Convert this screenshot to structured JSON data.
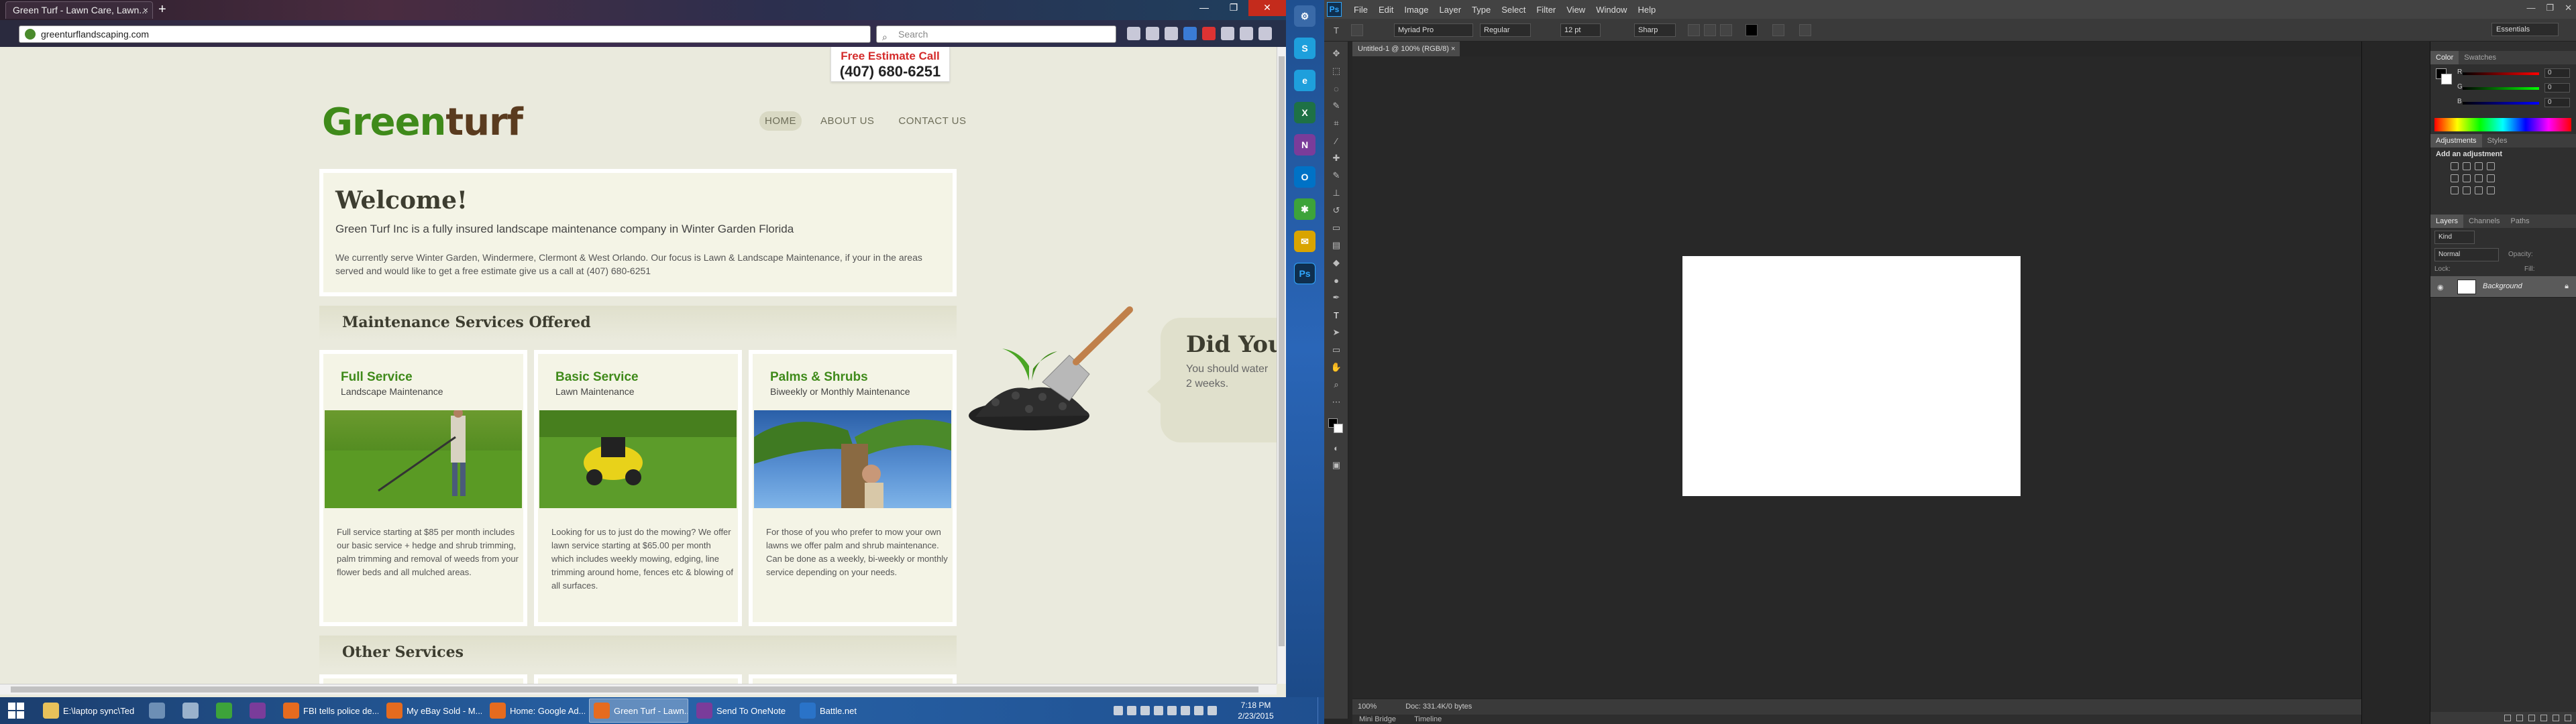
{
  "browser": {
    "tab_title": "Green Turf - Lawn Care, Lawn...",
    "tab_close": "×",
    "new_tab": "+",
    "url": "greenturflandscaping.com",
    "search_placeholder": "Search"
  },
  "site": {
    "logo_green": "Green",
    "logo_brown": "turf",
    "estimate_label": "Free Estimate Call",
    "estimate_phone": "(407) 680-6251",
    "nav": [
      "HOME",
      "ABOUT US",
      "CONTACT US"
    ],
    "welcome_title": "Welcome!",
    "welcome_lead": "Green Turf Inc is a fully insured landscape maintenance company in Winter Garden Florida",
    "welcome_body": "We currently serve Winter Garden, Windermere, Clermont & West Orlando. Our focus is Lawn & Landscape Maintenance, if your in the areas served and would like to get a free estimate give us a call at (407) 680-6251",
    "maintenance_heading": "Maintenance Services Offered",
    "other_heading": "Other Services",
    "cards": [
      {
        "title": "Full Service",
        "subtitle": "Landscape Maintenance",
        "desc": "Full service starting at $85 per month includes our basic service + hedge and shrub trimming, palm trimming and removal of weeds from your flower beds and all mulched areas."
      },
      {
        "title": "Basic Service",
        "subtitle": "Lawn Maintenance",
        "desc": "Looking for us to just do the mowing? We offer lawn service starting at $65.00 per month which includes weekly mowing, edging, line trimming around home, fences etc & blowing of all surfaces."
      },
      {
        "title": "Palms & Shrubs",
        "subtitle": "Biweekly or Monthly Maintenance",
        "desc": "For those of you who prefer to mow your own lawns we offer palm and shrub maintenance. Can be done as a weekly, bi-weekly or monthly service depending on your needs."
      }
    ],
    "did_you_title": "Did You",
    "did_you_line1": "You should water",
    "did_you_line2": "2 weeks."
  },
  "taskbar": {
    "items": [
      {
        "label": "E:\\laptop sync\\Ted",
        "color": "#e8c15a"
      },
      {
        "label": "",
        "color": "#6d8fb5"
      },
      {
        "label": "",
        "color": "#9ab2cc"
      },
      {
        "label": "",
        "color": "#3da33a"
      },
      {
        "label": "",
        "color": "#7a3c9a"
      },
      {
        "label": "FBI tells police de...",
        "color": "#e56b1f"
      },
      {
        "label": "My eBay Sold - M...",
        "color": "#e56b1f"
      },
      {
        "label": "Home: Google Ad...",
        "color": "#e56b1f"
      },
      {
        "label": "Green Turf - Lawn...",
        "color": "#e56b1f"
      },
      {
        "label": "Send To OneNote",
        "color": "#7a3c9a"
      },
      {
        "label": "Battle.net",
        "color": "#2a73c8"
      }
    ],
    "time": "7:18 PM",
    "date": "2/23/2015"
  },
  "launcher": [
    {
      "icon": "S",
      "color": "#1e9fdc"
    },
    {
      "icon": "e",
      "color": "#1e9fdc"
    },
    {
      "icon": "X",
      "color": "#1e7145"
    },
    {
      "icon": "N",
      "color": "#7a3c9a"
    },
    {
      "icon": "O",
      "color": "#0072c6"
    },
    {
      "icon": "✱",
      "color": "#3da33a"
    },
    {
      "icon": "✉",
      "color": "#d9a400"
    },
    {
      "icon": "Ps",
      "color": "#0f2f4e"
    }
  ],
  "photoshop": {
    "logo": "Ps",
    "menu": [
      "File",
      "Edit",
      "Image",
      "Layer",
      "Type",
      "Select",
      "Filter",
      "View",
      "Window",
      "Help"
    ],
    "font_family": "Myriad Pro",
    "font_style": "Regular",
    "font_size": "12 pt",
    "antialias": "Sharp",
    "workspace": "Essentials",
    "doc_tab": "Untitled-1 @ 100% (RGB/8)",
    "zoom": "100%",
    "doc_info": "Doc: 331.4K/0 bytes",
    "bottom_tabs": [
      "Mini Bridge",
      "Timeline"
    ],
    "color_tabs": [
      "Color",
      "Swatches"
    ],
    "rgb": [
      {
        "label": "R",
        "value": "0"
      },
      {
        "label": "G",
        "value": "0"
      },
      {
        "label": "B",
        "value": "0"
      }
    ],
    "adjust_tabs": [
      "Adjustments",
      "Styles"
    ],
    "adjust_heading": "Add an adjustment",
    "layers_tabs": [
      "Layers",
      "Channels",
      "Paths"
    ],
    "layers_kind": "Kind",
    "blend_mode": "Normal",
    "opacity_label": "Opacity:",
    "lock_label": "Lock:",
    "fill_label": "Fill:",
    "layer_name": "Background"
  }
}
